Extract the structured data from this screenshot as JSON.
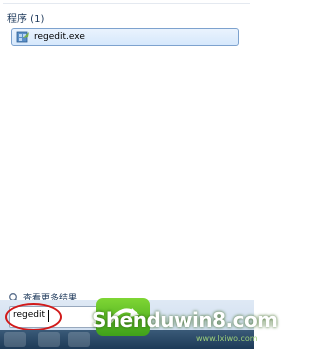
{
  "section": {
    "header": "程序 (1)"
  },
  "results": [
    {
      "label": "regedit.exe",
      "icon": "regedit-icon"
    }
  ],
  "more_results": {
    "label": "查看更多结果",
    "icon": "search-icon"
  },
  "search": {
    "value": "regedit"
  },
  "watermark": {
    "text": "Shenduwin8.com",
    "sub": "www.lxiwo.com"
  },
  "colors": {
    "highlight_border": "#7da2ce",
    "annotation": "#d11a1a"
  }
}
